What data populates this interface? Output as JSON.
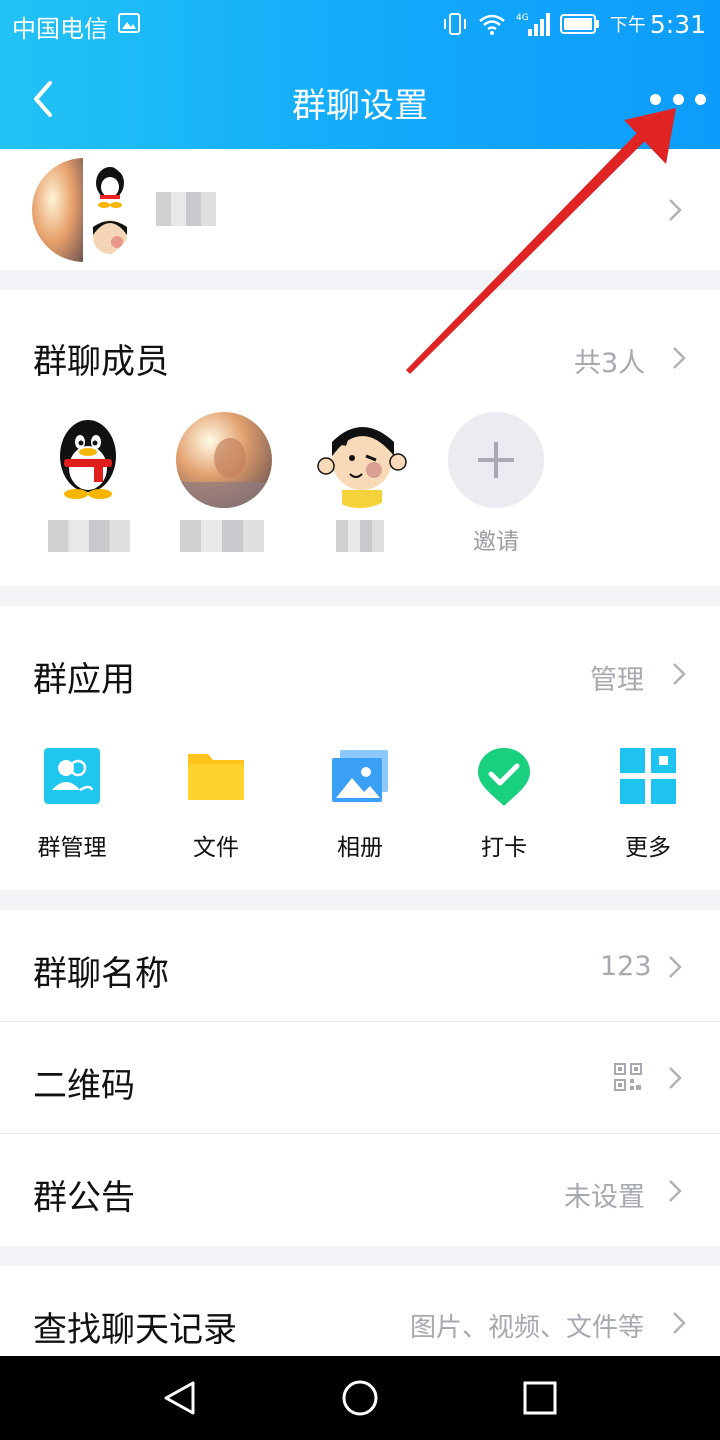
{
  "status_bar": {
    "carrier": "中国电信",
    "time_prefix": "下午",
    "time": "5:31"
  },
  "navbar": {
    "title": "群聊设置",
    "back_icon": "chevron-left-icon",
    "more_icon": "more-dots-icon"
  },
  "members": {
    "title": "群聊成员",
    "count_label": "共3人",
    "invite_label": "邀请"
  },
  "apps": {
    "title": "群应用",
    "manage_label": "管理",
    "items": [
      {
        "label": "群管理",
        "icon": "group-manage-icon",
        "color": "#1fc7ef"
      },
      {
        "label": "文件",
        "icon": "folder-icon",
        "color": "#ffc21a"
      },
      {
        "label": "相册",
        "icon": "album-icon",
        "color": "#3aa0f5"
      },
      {
        "label": "打卡",
        "icon": "check-in-icon",
        "color": "#19d07e"
      },
      {
        "label": "更多",
        "icon": "grid-more-icon",
        "color": "#1ec3ef"
      }
    ]
  },
  "settings": {
    "group_name": {
      "title": "群聊名称",
      "value": "123"
    },
    "qr_code": {
      "title": "二维码",
      "icon": "qr-code-icon"
    },
    "notice": {
      "title": "群公告",
      "value": "未设置"
    },
    "search_history": {
      "title": "查找聊天记录",
      "value": "图片、视频、文件等"
    }
  },
  "colors": {
    "header_start": "#22c3f5",
    "header_end": "#0d9cfb",
    "arrow": "#e02424",
    "secondary_text": "#a7a9b1"
  }
}
